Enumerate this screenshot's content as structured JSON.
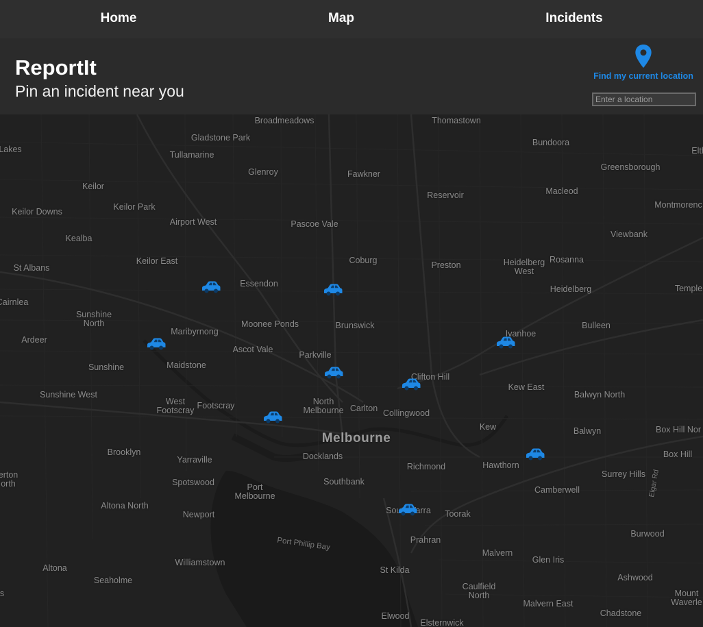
{
  "nav": {
    "home": "Home",
    "map": "Map",
    "incidents": "Incidents"
  },
  "header": {
    "title": "ReportIt",
    "subtitle": "Pin an incident near you",
    "locate_label": "Find my current location",
    "location_placeholder": "Enter a location"
  },
  "colors": {
    "accent": "#1e88e5",
    "map_background": "#212121",
    "navbar": "#2f2f2f",
    "header": "#2b2b2b"
  },
  "map": {
    "city": "Melbourne",
    "bay": "Port Phillip Bay",
    "road": "Elgar Rd",
    "places": [
      "Broadmeadows",
      "Thomastown",
      "Gladstone Park",
      "Bundoora",
      "Lakes",
      "Elth",
      "Tullamarine",
      "Glenroy",
      "Fawkner",
      "Greensborough",
      "Keilor",
      "Reservoir",
      "Macleod",
      "Keilor Park",
      "Keilor Downs",
      "Montmorenc",
      "Airport West",
      "Pascoe Vale",
      "Viewbank",
      "Kealba",
      "Coburg",
      "Preston",
      "Heidelberg\nWest",
      "Rosanna",
      "Keilor East",
      "St Albans",
      "Essendon",
      "Heidelberg",
      "Temple",
      "Cairnlea",
      "Sunshine\nNorth",
      "Moonee Ponds",
      "Brunswick",
      "Bulleen",
      "Maribyrnong",
      "Ardeer",
      "Ivanhoe",
      "Ascot Vale",
      "Parkville",
      "Sunshine",
      "Maidstone",
      "Clifton Hill",
      "Kew East",
      "Sunshine West",
      "Balwyn North",
      "West\nFootscray",
      "Footscray",
      "North\nMelbourne",
      "Carlton",
      "Collingwood",
      "Kew",
      "Balwyn",
      "Box Hill Nor",
      "Docklands",
      "Brooklyn",
      "Box Hill",
      "Yarraville",
      "Richmond",
      "Hawthorn",
      "erton\north",
      "Surrey Hills",
      "Spotswood",
      "Southbank",
      "Port\nMelbourne",
      "Camberwell",
      "Altona North",
      "Newport",
      "South Yarra",
      "Toorak",
      "Burwood",
      "Prahran",
      "Williamstown",
      "Malvern",
      "Glen Iris",
      "Altona",
      "St Kilda",
      "Ashwood",
      "Seaholme",
      "Caulfield\nNorth",
      "s",
      "Mount\nWaverle",
      "Malvern East",
      "Chadstone",
      "Elwood",
      "Elsternwick"
    ],
    "incident_icon": "car-icon",
    "incident_count": 10
  }
}
